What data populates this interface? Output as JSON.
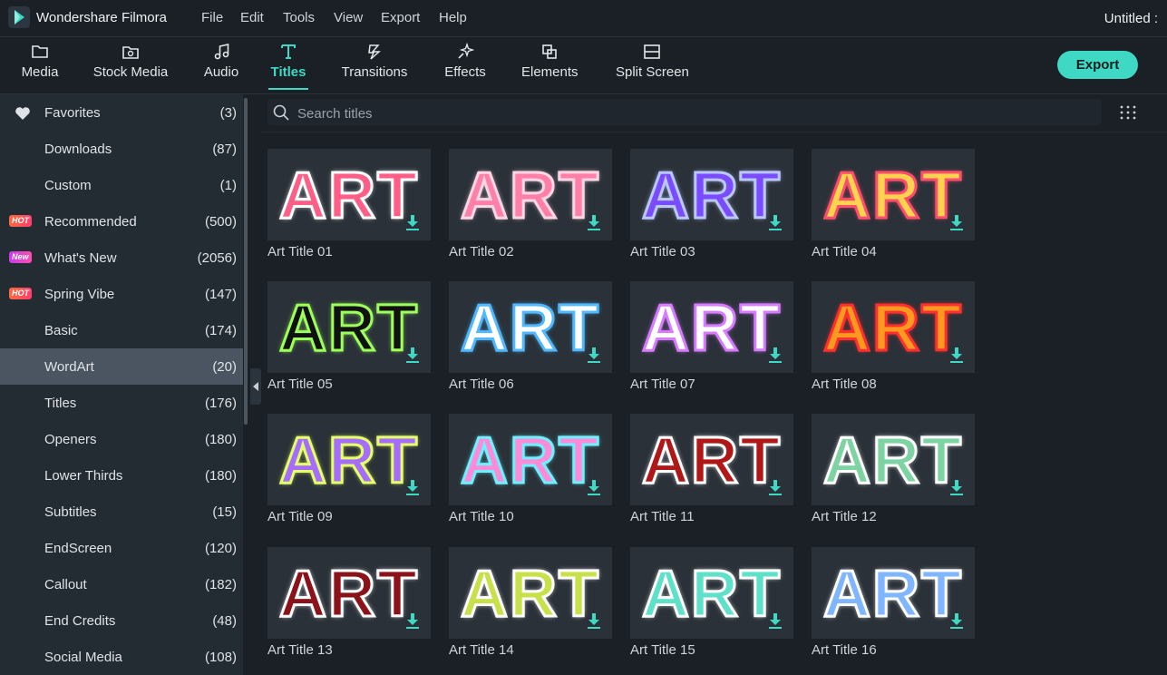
{
  "app": {
    "name": "Wondershare Filmora",
    "document_title": "Untitled :"
  },
  "menu": [
    "File",
    "Edit",
    "Tools",
    "View",
    "Export",
    "Help"
  ],
  "tabs": [
    {
      "label": "Media",
      "icon": "folder-icon"
    },
    {
      "label": "Stock Media",
      "icon": "stock-media-icon"
    },
    {
      "label": "Audio",
      "icon": "music-note-icon"
    },
    {
      "label": "Titles",
      "icon": "titles-t-icon",
      "active": true
    },
    {
      "label": "Transitions",
      "icon": "transitions-icon"
    },
    {
      "label": "Effects",
      "icon": "effects-sparkle-icon"
    },
    {
      "label": "Elements",
      "icon": "elements-icon"
    },
    {
      "label": "Split Screen",
      "icon": "split-screen-icon"
    }
  ],
  "export_label": "Export",
  "sidebar": [
    {
      "label": "Favorites",
      "count": "(3)",
      "heart": true
    },
    {
      "label": "Downloads",
      "count": "(87)"
    },
    {
      "label": "Custom",
      "count": "(1)"
    },
    {
      "label": "Recommended",
      "count": "(500)",
      "badge": "HOT"
    },
    {
      "label": "What's New",
      "count": "(2056)",
      "badge": "New"
    },
    {
      "label": "Spring Vibe",
      "count": "(147)",
      "badge": "HOT"
    },
    {
      "label": "Basic",
      "count": "(174)"
    },
    {
      "label": "WordArt",
      "count": "(20)",
      "active": true
    },
    {
      "label": "Titles",
      "count": "(176)"
    },
    {
      "label": "Openers",
      "count": "(180)"
    },
    {
      "label": "Lower Thirds",
      "count": "(180)"
    },
    {
      "label": "Subtitles",
      "count": "(15)"
    },
    {
      "label": "EndScreen",
      "count": "(120)"
    },
    {
      "label": "Callout",
      "count": "(182)"
    },
    {
      "label": "End Credits",
      "count": "(48)"
    },
    {
      "label": "Social Media",
      "count": "(108)"
    }
  ],
  "search": {
    "placeholder": "Search titles"
  },
  "colors": {
    "accent": "#3fd8c4",
    "background": "#1a2026",
    "sidebar": "#232b33",
    "sidebar_active": "#4a5561",
    "thumb_bg": "#2a3138"
  },
  "titles": [
    {
      "label": "Art Title 01",
      "art": "ART",
      "fill": "#ff5e86",
      "stroke": "#ffffff"
    },
    {
      "label": "Art Title 02",
      "art": "ART",
      "fill": "#ff7fa8",
      "stroke": "#ffd6e4"
    },
    {
      "label": "Art Title 03",
      "art": "ART",
      "fill": "#7a4bff",
      "stroke": "#b9c8ff"
    },
    {
      "label": "Art Title 04",
      "art": "ART",
      "fill": "#ffd34d",
      "stroke": "#ff4d6d"
    },
    {
      "label": "Art Title 05",
      "art": "ART",
      "fill": "#111111",
      "stroke": "#9cff5a"
    },
    {
      "label": "Art Title 06",
      "art": "ART",
      "fill": "#ffffff",
      "stroke": "#4fb8ff"
    },
    {
      "label": "Art Title 07",
      "art": "ART",
      "fill": "#ffffff",
      "stroke": "#d77bff"
    },
    {
      "label": "Art Title 08",
      "art": "ART",
      "fill": "#ff9a1f",
      "stroke": "#ff2f2f"
    },
    {
      "label": "Art Title 09",
      "art": "ART",
      "fill": "#a66bff",
      "stroke": "#e4ff6b"
    },
    {
      "label": "Art Title 10",
      "art": "ART",
      "fill": "#ff8ad8",
      "stroke": "#6ff0ff"
    },
    {
      "label": "Art Title 11",
      "art": "ART",
      "fill": "#b01818",
      "stroke": "#ffffff"
    },
    {
      "label": "Art Title 12",
      "art": "ART",
      "fill": "#7ed3a2",
      "stroke": "#ffffff"
    },
    {
      "label": "Art Title 13",
      "art": "ART",
      "fill": "#8b1219",
      "stroke": "#ffffff"
    },
    {
      "label": "Art Title 14",
      "art": "ART",
      "fill": "#c8e04a",
      "stroke": "#ffffff"
    },
    {
      "label": "Art Title 15",
      "art": "ART",
      "fill": "#5fe0c8",
      "stroke": "#ffffff"
    },
    {
      "label": "Art Title 16",
      "art": "ART",
      "fill": "#7fb6ff",
      "stroke": "#ffffff"
    }
  ]
}
